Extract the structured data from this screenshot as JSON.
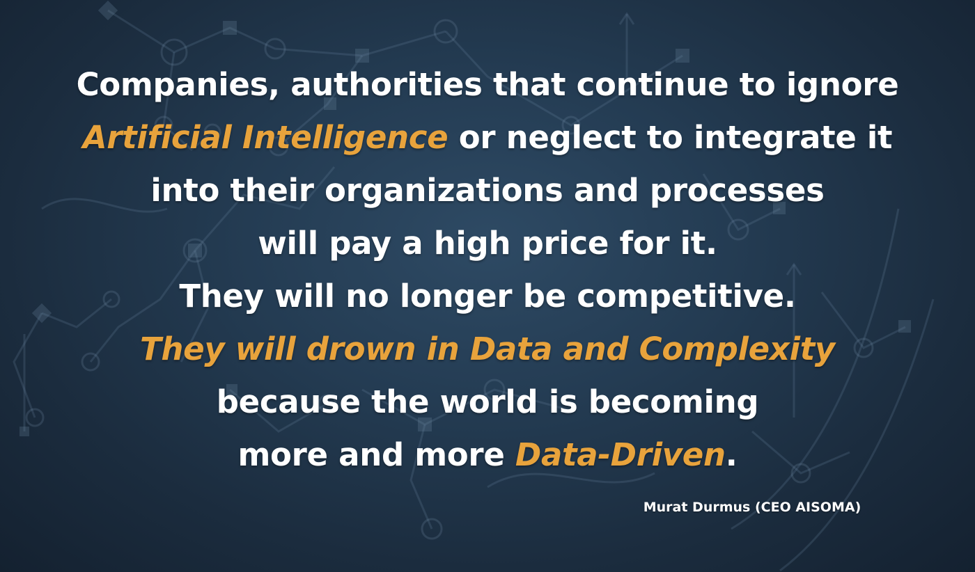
{
  "quote": {
    "line1": "Companies, authorities that continue to ignore",
    "line2_highlight": "Artificial Intelligence",
    "line2_rest": " or neglect to integrate it",
    "line3": "into their organizations and processes",
    "line4": "will pay a high price for it.",
    "line5": "They will no longer be competitive.",
    "line6_highlight": "They will drown in Data and Complexity",
    "line7": "because the world is becoming",
    "line8_start": "more and more ",
    "line8_highlight": "Data-Driven",
    "line8_end": "."
  },
  "attribution": "Murat Durmus (CEO AISOMA)",
  "colors": {
    "text": "#ffffff",
    "highlight": "#e8a33c",
    "background": "#1f3347"
  }
}
